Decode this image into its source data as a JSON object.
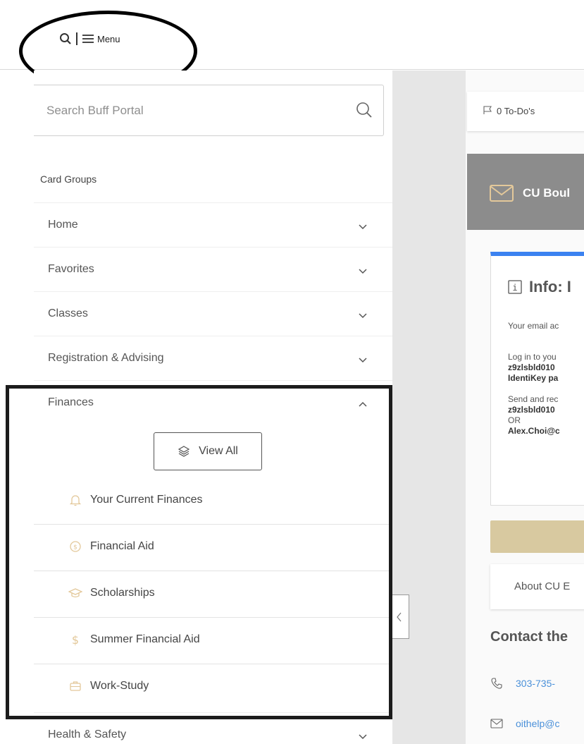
{
  "topbar": {
    "menu_label": "Menu"
  },
  "sidebar": {
    "search_placeholder": "Search Buff Portal",
    "card_groups_label": "Card Groups",
    "groups": [
      {
        "label": "Home",
        "expanded": false
      },
      {
        "label": "Favorites",
        "expanded": false
      },
      {
        "label": "Classes",
        "expanded": false
      },
      {
        "label": "Registration & Advising",
        "expanded": false
      },
      {
        "label": "Finances",
        "expanded": true
      },
      {
        "label": "Health & Safety",
        "expanded": false
      }
    ],
    "view_all_label": "View All",
    "finance_items": [
      {
        "label": "Your Current Finances",
        "icon": "bell-icon"
      },
      {
        "label": "Financial Aid",
        "icon": "dollar-circle-icon"
      },
      {
        "label": "Scholarships",
        "icon": "graduation-cap-icon"
      },
      {
        "label": "Summer Financial Aid",
        "icon": "dollar-icon"
      },
      {
        "label": "Work-Study",
        "icon": "briefcase-icon"
      }
    ]
  },
  "content": {
    "todo_label": "0 To-Do's",
    "banner_label": "CU Boul",
    "info": {
      "title": "Info: I",
      "line_email": "Your email ac",
      "login_line1": "Log in to you",
      "login_line2": "z9zlsbld010",
      "login_line3": "IdentiKey pa",
      "send_line1": "Send and rec",
      "send_line2": "z9zlsbld010",
      "send_or": "OR",
      "send_line3": "Alex.Choi@c"
    },
    "about_label": "About CU E",
    "contact_title": "Contact the",
    "phone": "303-735-",
    "email": "oithelp@c"
  },
  "colors": {
    "accent_gold": "#d8c9a0",
    "icon_gold": "#e3c89a",
    "info_blue": "#3b82f0",
    "banner_gray": "#8c8c8c",
    "link_blue": "#4a90d9"
  }
}
